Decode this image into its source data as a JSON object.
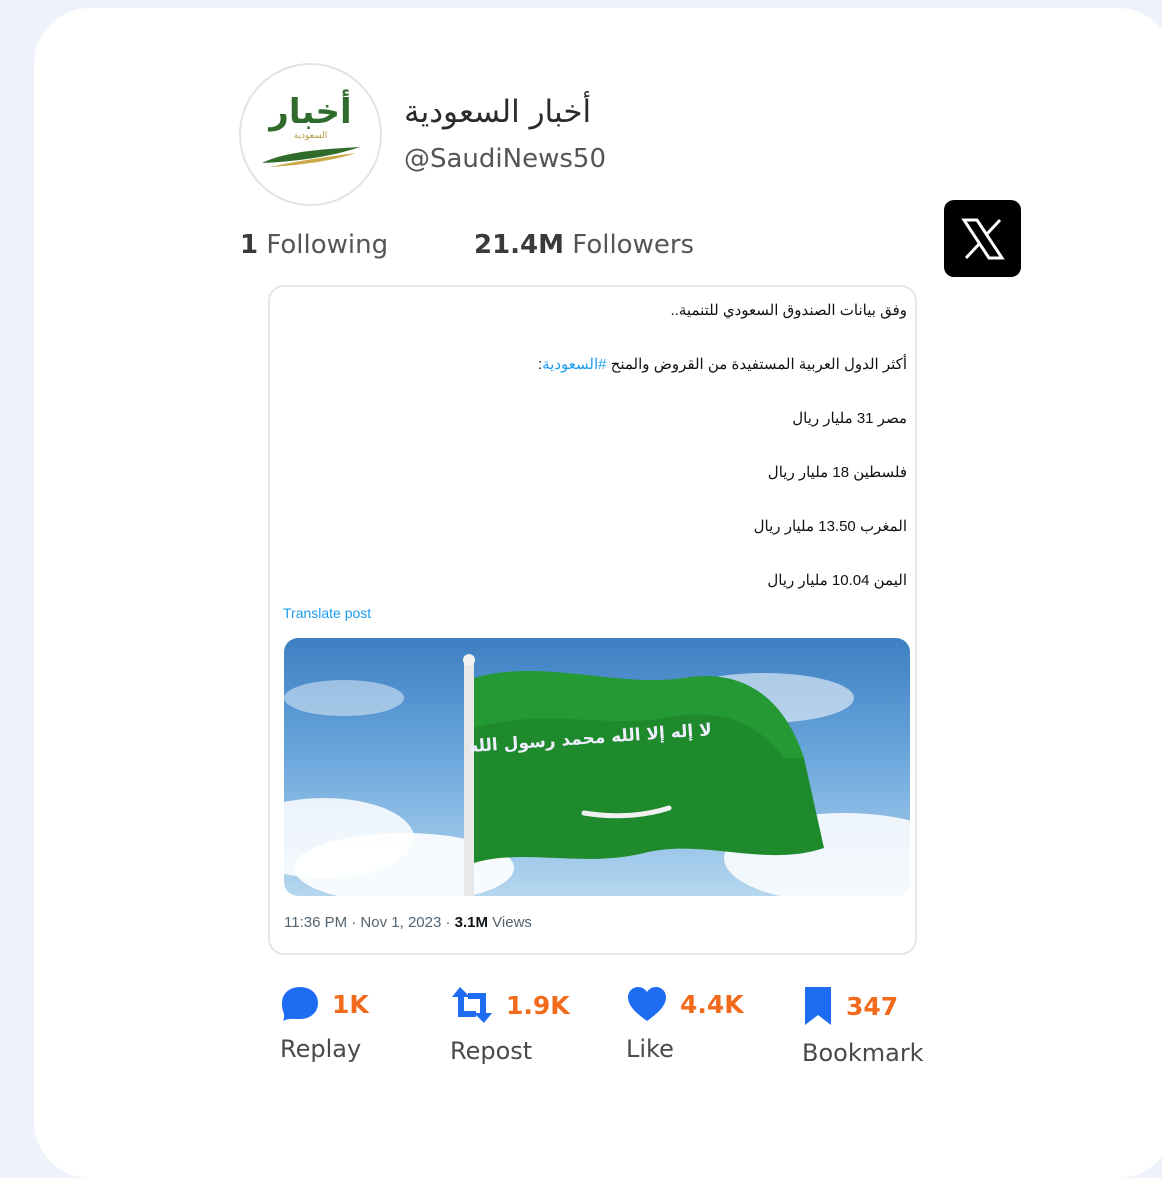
{
  "profile": {
    "logo_main": "أخبار",
    "logo_sub": "السعودية",
    "name": "أخبار السعودية",
    "handle": "@SaudiNews50"
  },
  "stats": {
    "following_count": "1",
    "following_label": "Following",
    "followers_count": "21.4M",
    "followers_label": "Followers"
  },
  "tweet": {
    "line1": "وفق بيانات الصندوق السعودي للتنمية..",
    "line2_text": "أكثر الدول العربية المستفيدة من القروض والمنح ",
    "line2_hashtag": "#السعودية",
    "line2_end": ":",
    "line3": "مصر 31 مليار ريال",
    "line4": "فلسطين 18 مليار ريال",
    "line5": "المغرب 13.50 مليار ريال",
    "line6": "اليمن 10.04 مليار ريال",
    "translate": "Translate post",
    "time": "11:36 PM · Nov 1, 2023 · ",
    "views_count": "3.1M",
    "views_label": " Views"
  },
  "image": {
    "flag_text": "لا إله إلا الله محمد رسول الله"
  },
  "actions": [
    {
      "count": "1K",
      "label": "Replay",
      "icon": "reply-bubble-icon"
    },
    {
      "count": "1.9K",
      "label": "Repost",
      "icon": "repost-icon"
    },
    {
      "count": "4.4K",
      "label": "Like",
      "icon": "heart-icon"
    },
    {
      "count": "347",
      "label": "Bookmark",
      "icon": "bookmark-icon"
    }
  ],
  "colors": {
    "accent": "#f26a1b",
    "icon_blue": "#1d6cf2",
    "link": "#1d9bf0",
    "flag_green": "#1f8a2b"
  }
}
